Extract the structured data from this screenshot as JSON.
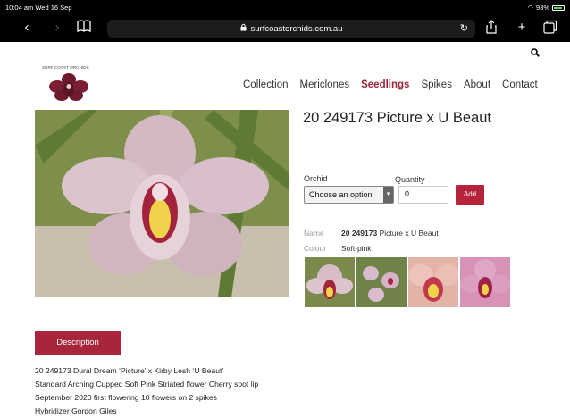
{
  "status": {
    "time": "10:04 am  Wed 16 Sep",
    "battery": "93%",
    "battery_level": 0.93
  },
  "browser": {
    "url": "surfcoastorchids.com.au",
    "lock_icon": "lock-icon"
  },
  "site": {
    "logo_text": "SURF COAST ORCHIDS"
  },
  "nav": {
    "items": [
      "Collection",
      "Mericlones",
      "Seedlings",
      "Spikes",
      "About",
      "Contact"
    ],
    "active": "Seedlings"
  },
  "product": {
    "title": "20 249173 Picture x U Beaut",
    "orchid_label": "Orchid",
    "quantity_label": "Quantity",
    "select_value": "Choose an option",
    "quantity_value": "0",
    "add_label": "Add",
    "name_key": "Name",
    "name_code": "20 249173",
    "name_rest": "Picture x U Beaut",
    "colour_key": "Colour",
    "colour_value": "Soft-pink"
  },
  "description": {
    "tab_label": "Description",
    "lines": [
      "20 249173 Dural Dream ‘Picture’ x Kirby Lesh ‘U Beaut’",
      "Standard Arching Cupped Soft Pink Striated flower Cherry spot lip",
      "September 2020 first flowering 10 flowers on 2 spikes",
      "Hybridizer Gordon Giles"
    ]
  },
  "colors": {
    "brand": "#b5243a",
    "active_nav": "#9b2335"
  }
}
